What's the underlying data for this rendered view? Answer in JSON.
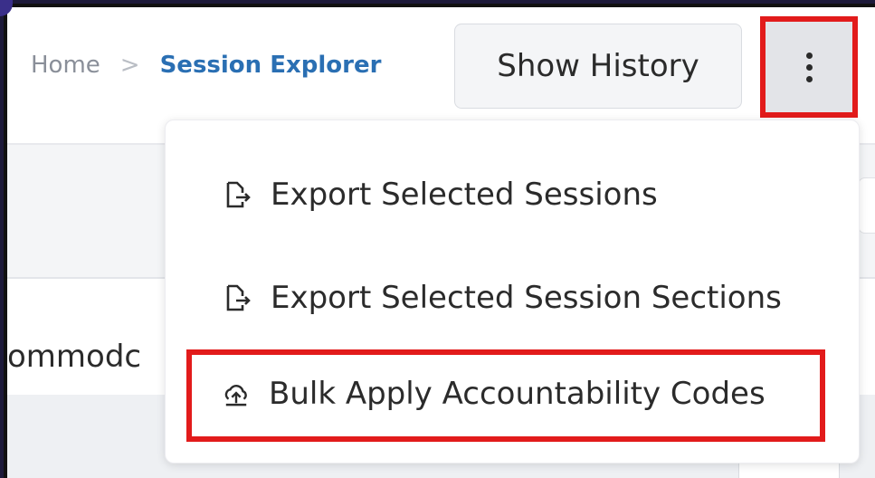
{
  "breadcrumb": {
    "home": "Home",
    "separator": ">",
    "current": "Session Explorer"
  },
  "toolbar": {
    "show_history_label": "Show History",
    "more_menu_icon": "kebab-vertical-icon"
  },
  "menu": {
    "items": [
      {
        "label": "Export Selected Sessions",
        "icon": "export-file-icon"
      },
      {
        "label": "Export Selected Session Sections",
        "icon": "export-file-icon"
      },
      {
        "label": "Bulk Apply Accountability Codes",
        "icon": "upload-cloud-icon"
      }
    ]
  },
  "background": {
    "partial_text": "ommodc"
  },
  "colors": {
    "highlight": "#e21b1b",
    "link": "#2a6fb3",
    "muted": "#8a8f99"
  }
}
